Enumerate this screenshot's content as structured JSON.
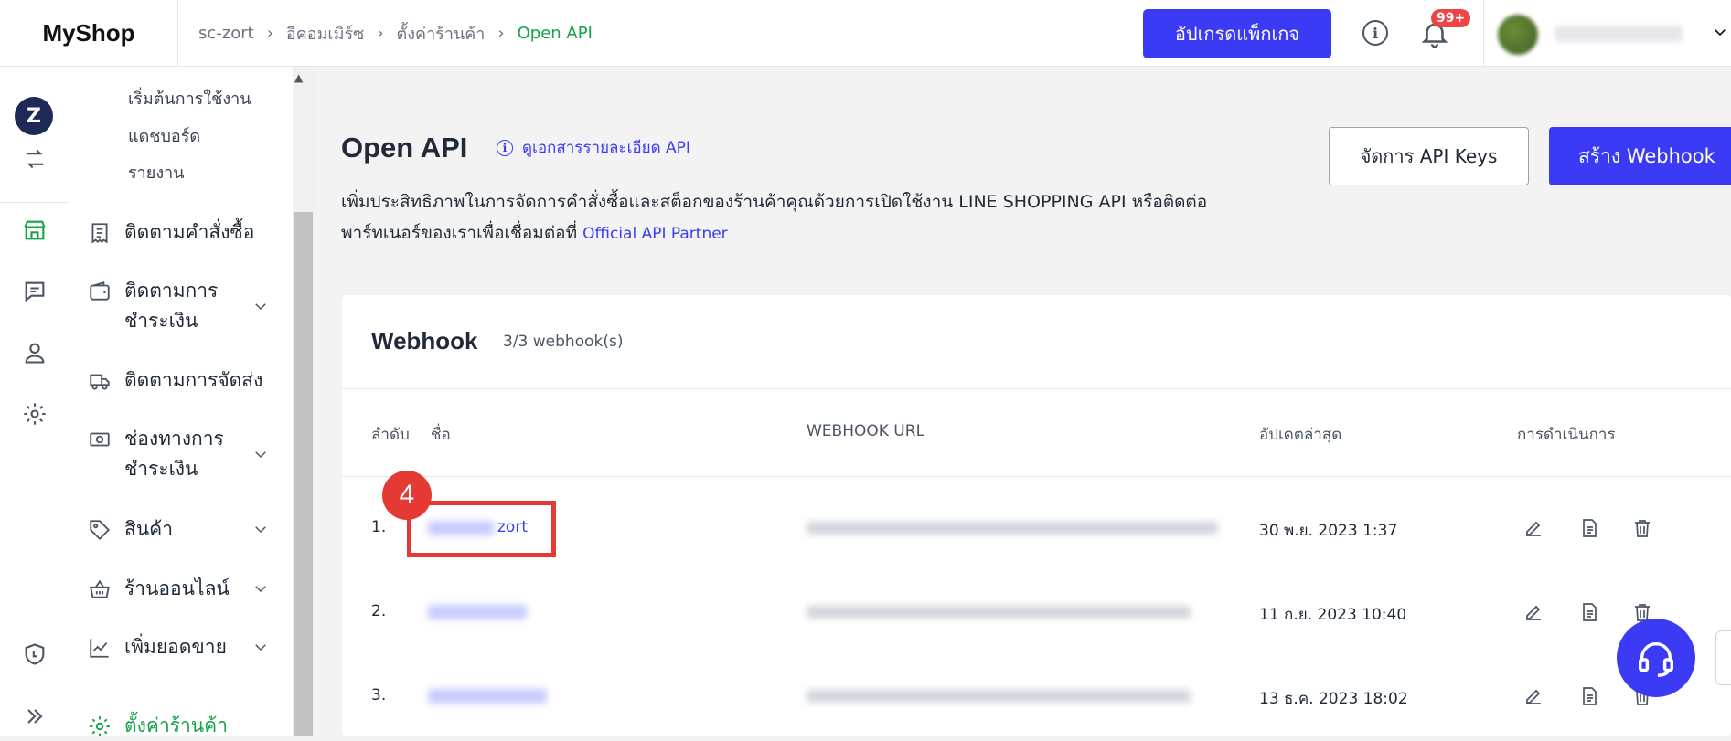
{
  "app": {
    "name": "MyShop"
  },
  "breadcrumb": [
    "sc-zort",
    "อีคอมเมิร์ซ",
    "ตั้งค่าร้านค้า",
    "Open API"
  ],
  "header": {
    "upgrade_label": "อัปเกรดแพ็กเกจ",
    "notification_badge": "99+"
  },
  "rail": {
    "store_initial": "Z"
  },
  "sidebar": {
    "sub_items": [
      "เริ่มต้นการใช้งาน",
      "แดชบอร์ด",
      "รายงาน"
    ],
    "items": [
      {
        "label": "ติดตามคำสั่งซื้อ",
        "icon": "receipt-icon"
      },
      {
        "label": "ติดตามการชำระเงิน",
        "icon": "wallet-icon"
      },
      {
        "label": "ติดตามการจัดส่ง",
        "icon": "truck-icon"
      },
      {
        "label": "ช่องทางการชำระเงิน",
        "icon": "cash-icon"
      },
      {
        "label": "สินค้า",
        "icon": "tag-icon"
      },
      {
        "label": "ร้านออนไลน์",
        "icon": "basket-icon"
      },
      {
        "label": "เพิ่มยอดขาย",
        "icon": "chart-icon"
      },
      {
        "label": "ตั้งค่าร้านค้า",
        "icon": "gear-icon"
      }
    ]
  },
  "page": {
    "title": "Open API",
    "doc_link": "ดูเอกสารรายละเอียด API",
    "description_line1": "เพิ่มประสิทธิภาพในการจัดการคำสั่งซื้อและสต็อกของร้านค้าคุณด้วยการเปิดใช้งาน LINE SHOPPING API หรือติดต่อ",
    "description_line2": "พาร์ทเนอร์ของเราเพื่อเชื่อมต่อที่",
    "partner_link": "Official API Partner",
    "manage_keys_label": "จัดการ API Keys",
    "create_webhook_label": "สร้าง Webhook"
  },
  "webhook": {
    "title": "Webhook",
    "count": "3/3 webhook(s)",
    "columns": [
      "ลำดับ",
      "ชื่อ",
      "WEBHOOK URL",
      "อัปเดตล่าสุด",
      "การดำเนินการ"
    ],
    "rows": [
      {
        "index": "1.",
        "name_visible": "zort",
        "updated": "30 พ.ย. 2023 1:37"
      },
      {
        "index": "2.",
        "name_visible": "",
        "updated": "11 ก.ย. 2023 10:40"
      },
      {
        "index": "3.",
        "name_visible": "",
        "updated": "13 ธ.ค. 2023 18:02"
      }
    ]
  },
  "annotation": {
    "step": "4"
  },
  "colors": {
    "primary": "#3b3bf5",
    "active_green": "#16a34a",
    "highlight_red": "#e53935"
  }
}
